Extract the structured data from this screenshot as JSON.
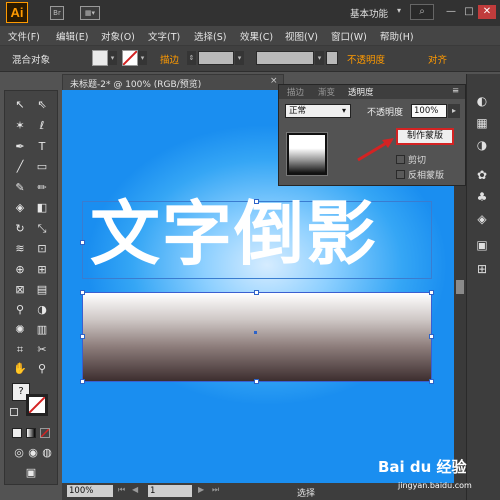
{
  "titlebar": {
    "logo": "Ai",
    "workspace": "基本功能",
    "workspace_arrow": "▾",
    "search_icon": "⌕",
    "window_buttons": {
      "minimize": "—",
      "maximize": "□",
      "close": "✕"
    }
  },
  "menubar": {
    "items": [
      "文件(F)",
      "编辑(E)",
      "对象(O)",
      "文字(T)",
      "选择(S)",
      "效果(C)",
      "视图(V)",
      "窗口(W)",
      "帮助(H)"
    ]
  },
  "controlbar": {
    "selection_label": "混合对象",
    "stroke_label": "描边",
    "opacity_link": "不透明度",
    "align_link": "对齐"
  },
  "document": {
    "tab_title": "未标题-2* @ 100% (RGB/预览)",
    "tab_close": "×",
    "artwork_text": "文字倒影"
  },
  "transparency_panel": {
    "tabs": [
      "描边",
      "渐变",
      "透明度"
    ],
    "active_tab": "透明度",
    "blend_mode": "正常",
    "opacity_label": "不透明度",
    "opacity_value": "100%",
    "make_mask_button": "制作蒙版",
    "clip_label": "剪切",
    "invert_mask_label": "反相蒙版",
    "menu_icon": "≡"
  },
  "statusbar": {
    "zoom": "100%",
    "page": "1",
    "status": "选择"
  },
  "watermark": {
    "text": "Bai du 经验",
    "url": "jingyan.baidu.com"
  },
  "colors": {
    "accent_orange": "#ff9a00",
    "highlight_red": "#d42323",
    "canvas_blue": "#1a8ef0",
    "selection_blue": "#2d63c8"
  }
}
